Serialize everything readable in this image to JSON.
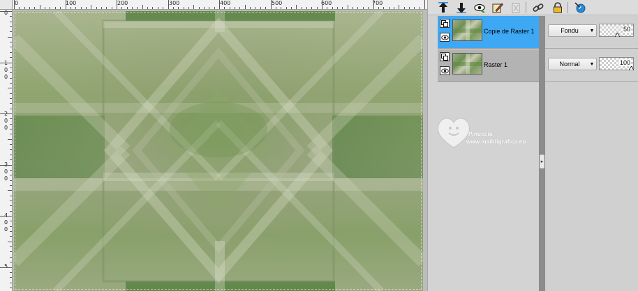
{
  "rulers": {
    "top_labels": [
      "0",
      "100",
      "200",
      "300",
      "400",
      "500",
      "600",
      "700"
    ],
    "left_labels": [
      [
        "0"
      ],
      [
        "1",
        "0",
        "0"
      ],
      [
        "2",
        "0",
        "0"
      ],
      [
        "3",
        "0",
        "0"
      ],
      [
        "4",
        "0",
        "0"
      ],
      [
        "5"
      ]
    ]
  },
  "layers_toolbar": {
    "icons": [
      "move-layer-up-icon",
      "move-layer-down-icon",
      "toggle-visibility-icon",
      "edit-layer-icon",
      "delete-layer-icon",
      "link-layer-icon",
      "lock-layer-icon",
      "layer-properties-icon"
    ]
  },
  "layers": [
    {
      "name": "Copie de Raster 1",
      "blend_mode": "Fondu",
      "opacity": "50",
      "selected": true
    },
    {
      "name": "Raster 1",
      "blend_mode": "Normal",
      "opacity": "100",
      "selected": false
    }
  ],
  "watermark": {
    "title": "Pinuccia",
    "url": "www.maildigrafica.eu"
  },
  "colors": {
    "selected_layer": "#3ea8f4",
    "panel_bg": "#d3d3d3",
    "splitter": "#8c8c8c"
  }
}
